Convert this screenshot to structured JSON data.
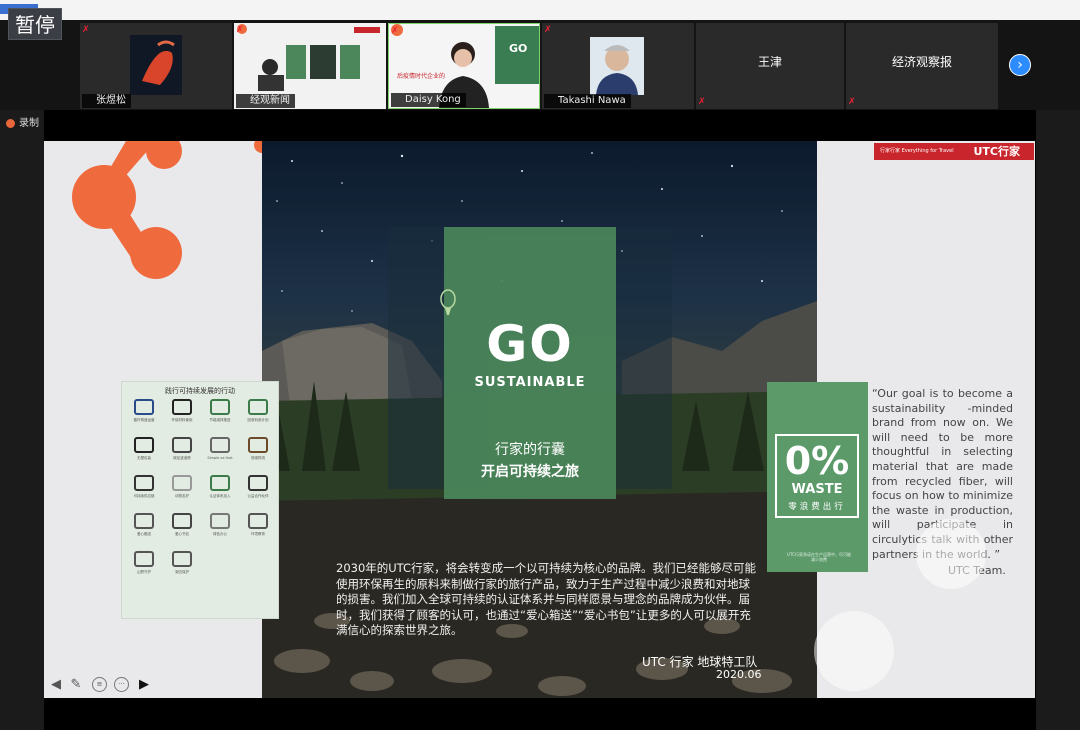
{
  "app": {
    "pause_label": "暂停",
    "record_label": "录制"
  },
  "participants": [
    {
      "name": "张煜松",
      "kind": "video"
    },
    {
      "name": "经观新闻",
      "kind": "video"
    },
    {
      "name": "Daisy Kong",
      "kind": "video"
    },
    {
      "name": "Takashi Nawa",
      "kind": "video"
    },
    {
      "name": "王津",
      "kind": "name-only"
    },
    {
      "name": "经济观察报",
      "kind": "name-only"
    }
  ],
  "strip": {
    "next_icon": "chevron-right-icon"
  },
  "slide": {
    "brand_badge_small": "行家行家 Everything for Travel",
    "brand_badge_big": "UTC行家",
    "go_text": "GO",
    "sustainable": "SUSTAINABLE",
    "subtitle_1": "行家的行囊",
    "subtitle_2": "开启可持续之旅",
    "body": "2030年的UTC行家，将会转变成一个以可持续为核心的品牌。我们已经能够尽可能使用环保再生的原料来制做行家的旅行产品，致力于生产过程中减少浪费和对地球的损害。我们加入全球可持续的认证体系并与同样愿景与理念的品牌成为伙伴。届时，我们获得了顾客的认可，也通过“爱心箱送”“爱心书包”让更多的人可以展开充满信心的探索世界之旅。",
    "team_cn": "UTC 行家  地球特工队",
    "date": "2020.06",
    "card_title": "践行可持续发展的行动",
    "card_items": [
      "循环再造运营",
      "环保材料使用",
      "节能减排推进",
      "回收利用计划",
      "无塑包装",
      "碳足迹追踪",
      "Simple as that",
      "低碳物流",
      "可持续供应链",
      "动物友好",
      "认证体系加入",
      "公益合作伙伴",
      "爱心箱送",
      "爱心书包",
      "绿色办公",
      "环境教育",
      "山野守护",
      "湖泊保护"
    ],
    "waste_pct": "0%",
    "waste_label": "WASTE",
    "waste_cn": "零浪费出行",
    "waste_small": "UTC行家承诺在生产运营中，尽可能减少浪费",
    "quote": "“Our goal is to become a sustainability -minded brand from now on. We will need to be more thoughtful in selecting material that are made from recycled fiber, will focus on how to minimize the waste in production, will participate in circulytics talk with other partners in the world. ”",
    "quote_sign": "UTC Team."
  },
  "toolbar": {
    "items": [
      "back-arrow-icon",
      "pen-icon",
      "options-icon",
      "more-icon",
      "forward-arrow-icon"
    ]
  },
  "colors": {
    "accent_orange": "#ef6a3d",
    "green_panel": "#4b875a",
    "brand_red": "#c9252c",
    "zoom_blue": "#2d8cff"
  }
}
